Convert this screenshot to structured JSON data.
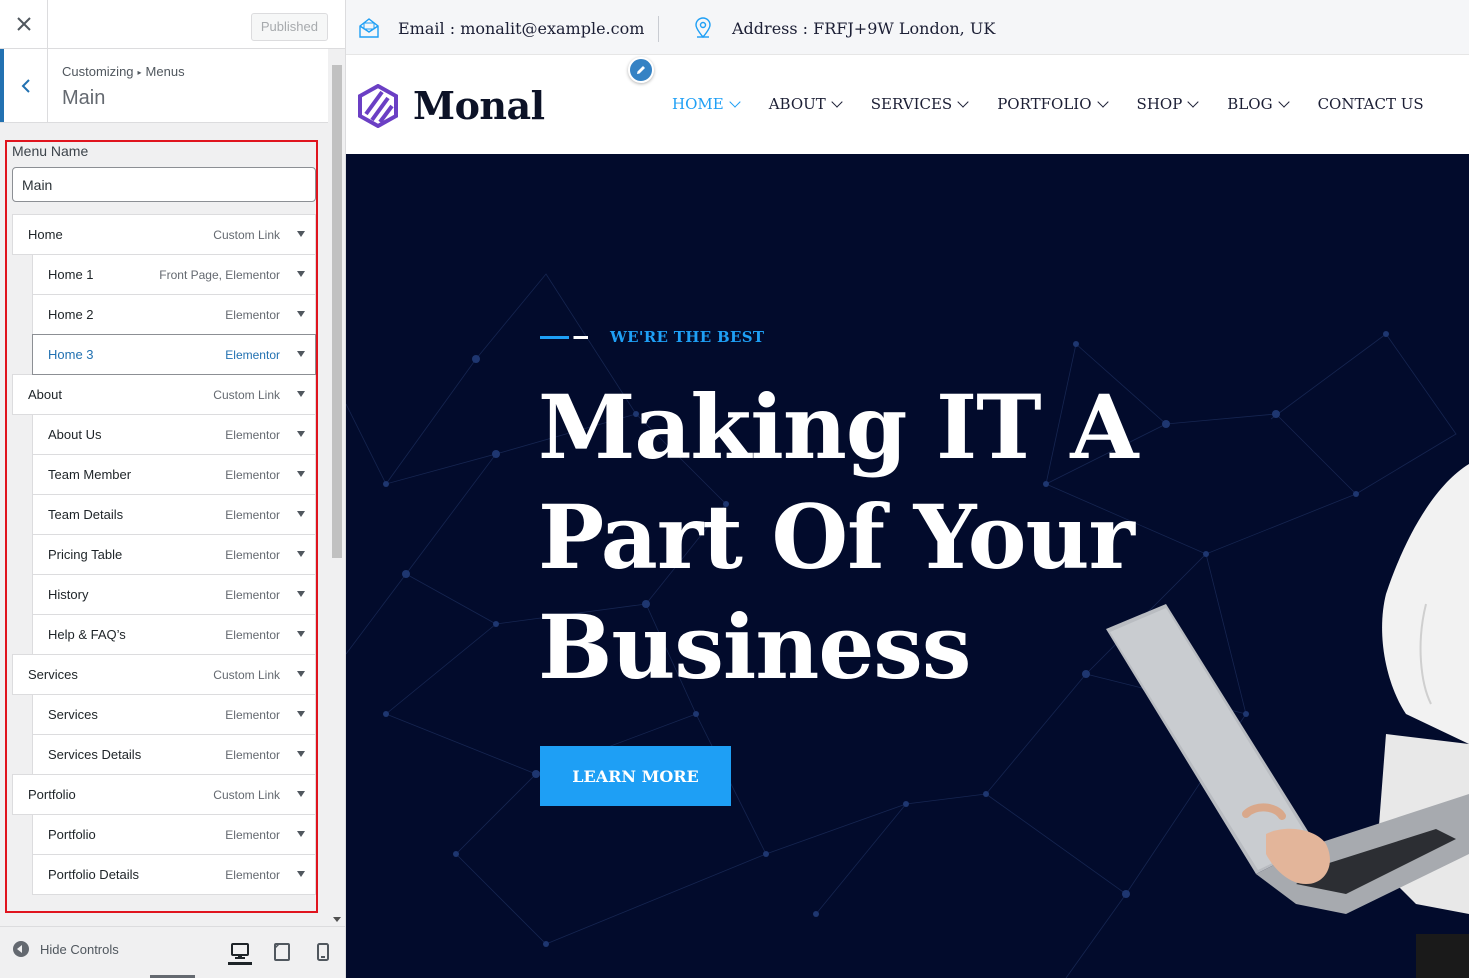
{
  "customizer": {
    "publish_label": "Published",
    "breadcrumb": {
      "root": "Customizing",
      "current": "Menus"
    },
    "section_title": "Main",
    "menu_name_label": "Menu Name",
    "menu_name_value": "Main",
    "menu_items": [
      {
        "title": "Home",
        "type": "Custom Link",
        "depth": 0
      },
      {
        "title": "Home 1",
        "type": "Front Page, Elementor",
        "depth": 1
      },
      {
        "title": "Home 2",
        "type": "Elementor",
        "depth": 1
      },
      {
        "title": "Home 3",
        "type": "Elementor",
        "depth": 1,
        "active": true
      },
      {
        "title": "About",
        "type": "Custom Link",
        "depth": 0
      },
      {
        "title": "About Us",
        "type": "Elementor",
        "depth": 1
      },
      {
        "title": "Team Member",
        "type": "Elementor",
        "depth": 1
      },
      {
        "title": "Team Details",
        "type": "Elementor",
        "depth": 1
      },
      {
        "title": "Pricing Table",
        "type": "Elementor",
        "depth": 1
      },
      {
        "title": "History",
        "type": "Elementor",
        "depth": 1
      },
      {
        "title": "Help & FAQ’s",
        "type": "Elementor",
        "depth": 1
      },
      {
        "title": "Services",
        "type": "Custom Link",
        "depth": 0
      },
      {
        "title": "Services",
        "type": "Elementor",
        "depth": 1
      },
      {
        "title": "Services Details",
        "type": "Elementor",
        "depth": 1
      },
      {
        "title": "Portfolio",
        "type": "Custom Link",
        "depth": 0
      },
      {
        "title": "Portfolio",
        "type": "Elementor",
        "depth": 1
      },
      {
        "title": "Portfolio Details",
        "type": "Elementor",
        "depth": 1
      }
    ],
    "hide_controls_label": "Hide Controls"
  },
  "site": {
    "topbar": {
      "email": "Email : monalit@example.com",
      "address": "Address : FRFJ+9W London, UK"
    },
    "logo_text": "Monal",
    "nav": [
      {
        "label": "HOME",
        "active": true,
        "has_dropdown": true
      },
      {
        "label": "ABOUT",
        "has_dropdown": true
      },
      {
        "label": "SERVICES",
        "has_dropdown": true
      },
      {
        "label": "PORTFOLIO",
        "has_dropdown": true
      },
      {
        "label": "SHOP",
        "has_dropdown": true
      },
      {
        "label": "BLOG",
        "has_dropdown": true
      },
      {
        "label": "CONTACT US",
        "has_dropdown": false
      }
    ],
    "hero": {
      "eyebrow": "WE'RE THE BEST",
      "title_lines": [
        "Making IT A",
        "Part Of Your",
        "Business"
      ],
      "button_label": "LEARN MORE"
    }
  },
  "colors": {
    "accent": "#1e9ff5",
    "hero_bg": "#020b2c",
    "highlight_border": "#e0141e",
    "wp_blue": "#2271b1",
    "logo_purple": "#6b3fc4"
  }
}
